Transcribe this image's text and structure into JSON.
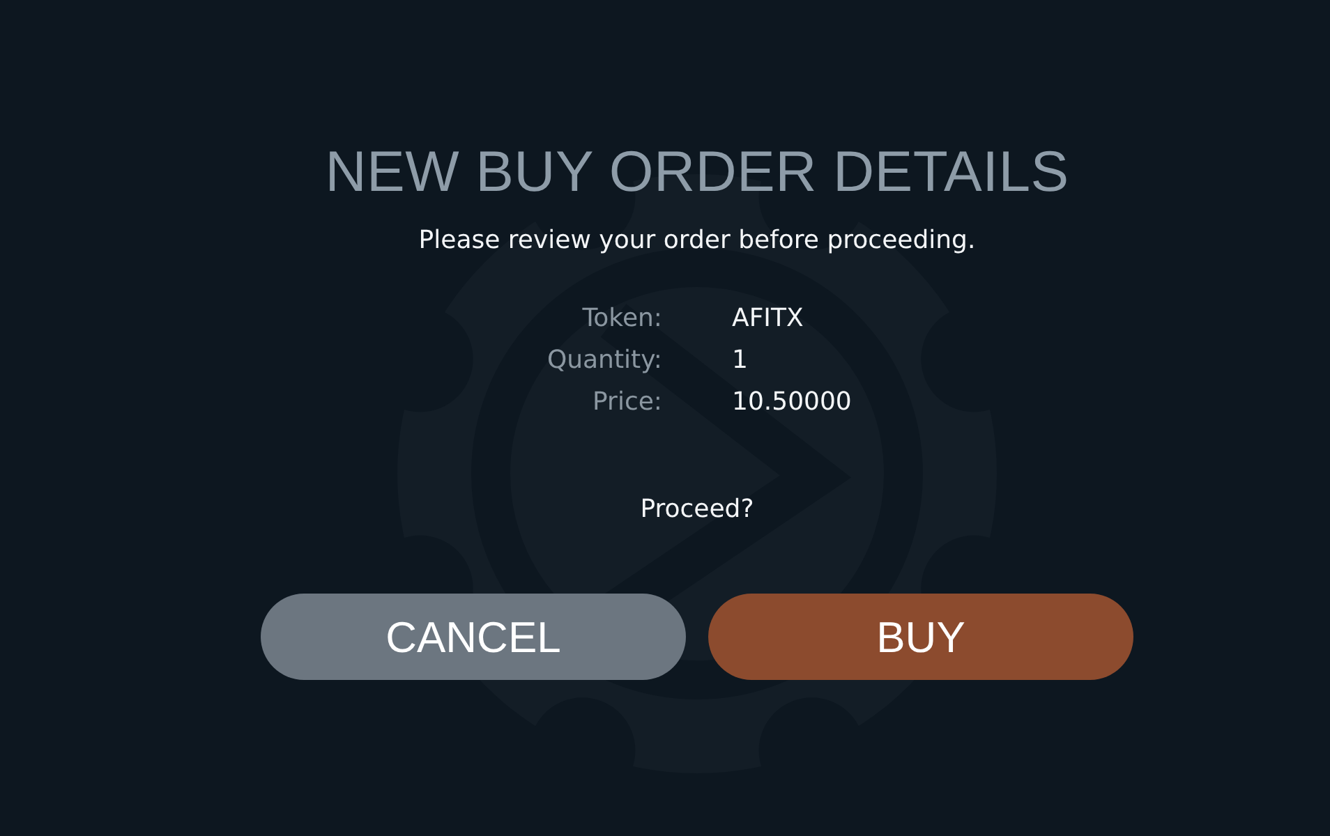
{
  "dialog": {
    "title": "NEW BUY ORDER DETAILS",
    "subtitle": "Please review your order before proceeding.",
    "details": [
      {
        "label": "Token:",
        "value": "AFITX"
      },
      {
        "label": "Quantity:",
        "value": "1"
      },
      {
        "label": "Price:",
        "value": "10.50000"
      }
    ],
    "prompt": "Proceed?",
    "buttons": [
      {
        "label": "CANCEL",
        "kind": "secondary"
      },
      {
        "label": "BUY",
        "kind": "primary"
      }
    ]
  }
}
